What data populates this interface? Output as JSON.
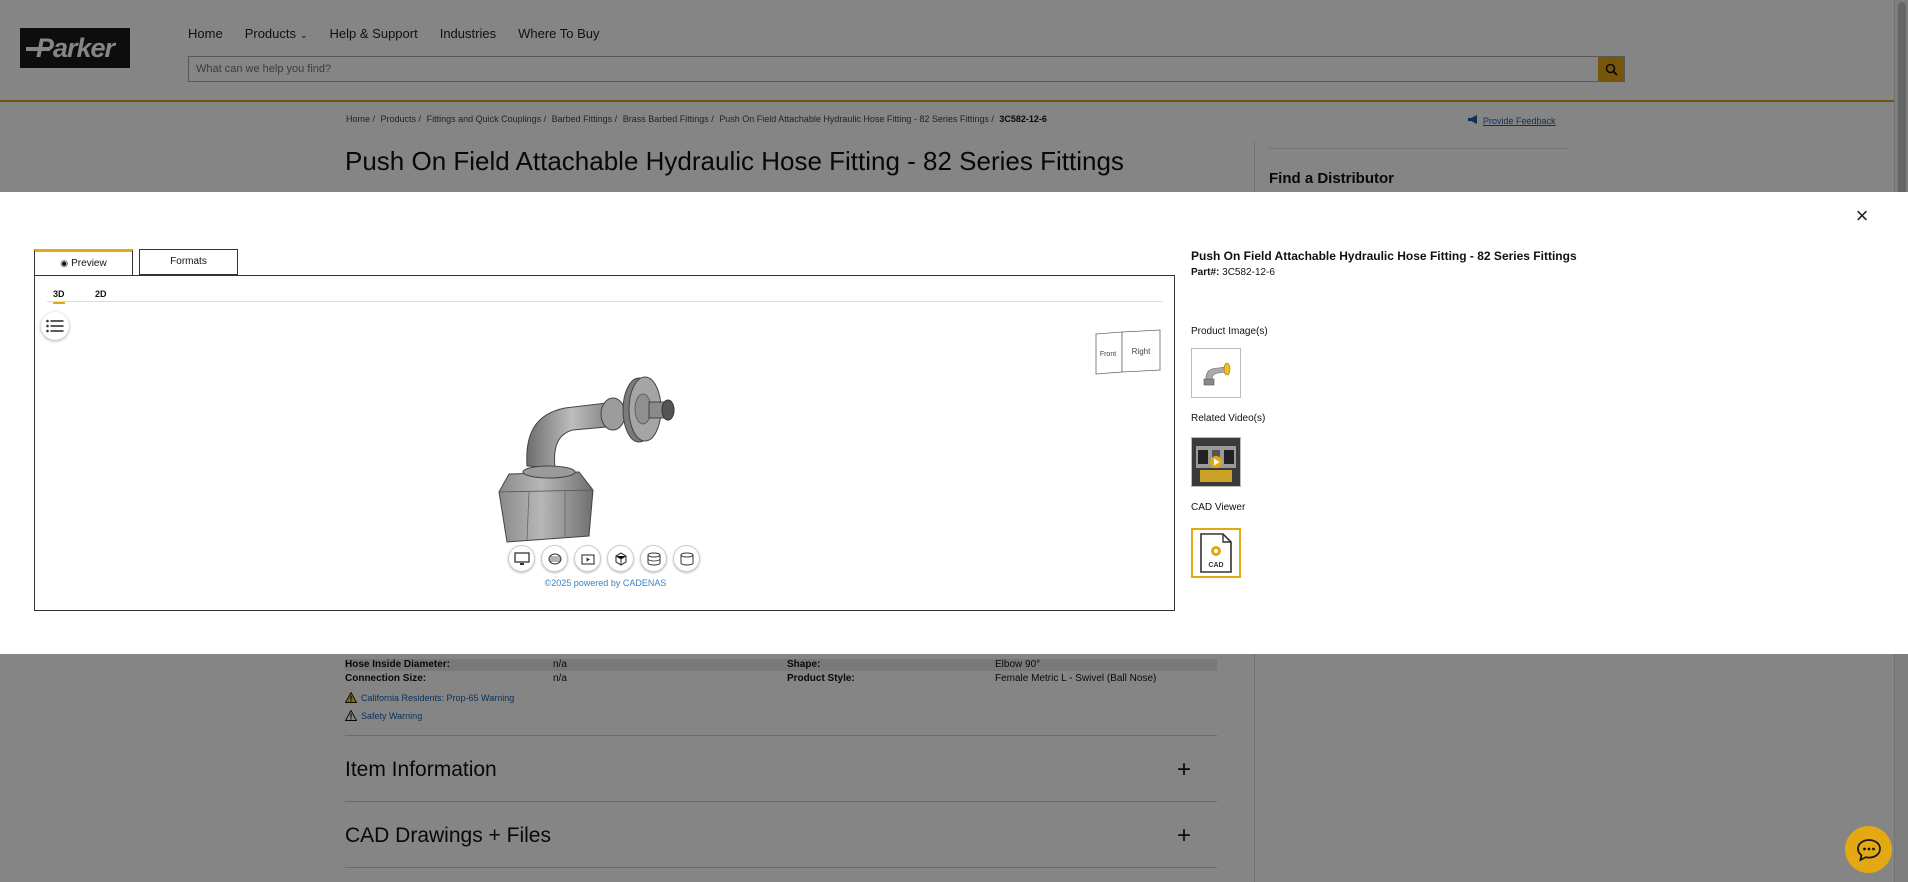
{
  "header": {
    "logo_text": "Parker",
    "nav": [
      {
        "label": "Home"
      },
      {
        "label": "Products",
        "has_dropdown": true
      },
      {
        "label": "Help & Support"
      },
      {
        "label": "Industries"
      },
      {
        "label": "Where To Buy"
      }
    ],
    "search_placeholder": "What can we help you find?"
  },
  "breadcrumb": [
    "Home /",
    "Products /",
    "Fittings and Quick Couplings /",
    "Barbed Fittings /",
    "Brass Barbed Fittings /",
    "Push On Field Attachable Hydraulic Hose Fitting - 82 Series Fittings /",
    "3C582-12-6"
  ],
  "feedback_label": "Provide Feedback",
  "page_title": "Push On Field Attachable Hydraulic Hose Fitting - 82 Series Fittings",
  "distributor_title": "Find a Distributor",
  "specs": [
    {
      "label": "Hose Inside Diameter:",
      "value": "n/a",
      "label2": "Shape:",
      "value2": "Elbow 90°"
    },
    {
      "label": "Connection Size:",
      "value": "n/a",
      "label2": "Product Style:",
      "value2": "Female Metric L - Swivel (Ball Nose)"
    }
  ],
  "warnings": [
    "California Residents: Prop-65 Warning",
    "Safety Warning"
  ],
  "sections": [
    {
      "title": "Item Information",
      "icon": "+"
    },
    {
      "title": "CAD Drawings + Files",
      "icon": "+"
    }
  ],
  "modal": {
    "close_icon": "×",
    "tabs": {
      "preview": "Preview",
      "formats": "Formats"
    },
    "view_tabs": {
      "three_d": "3D",
      "two_d": "2D"
    },
    "viewcube": {
      "front": "Front",
      "right": "Right"
    },
    "powered_by": "©2025 powered by CADENAS",
    "product_title": "Push On Field Attachable Hydraulic Hose Fitting - 82 Series Fittings",
    "part_label": "Part#:",
    "part_number": "3C582-12-6",
    "product_images_label": "Product Image(s)",
    "related_videos_label": "Related Video(s)",
    "cad_viewer_label": "CAD Viewer",
    "cad_icon_text": "CAD"
  },
  "colors": {
    "accent": "#e3a812",
    "link": "#1a5fa8",
    "header_border": "#d4a017"
  }
}
